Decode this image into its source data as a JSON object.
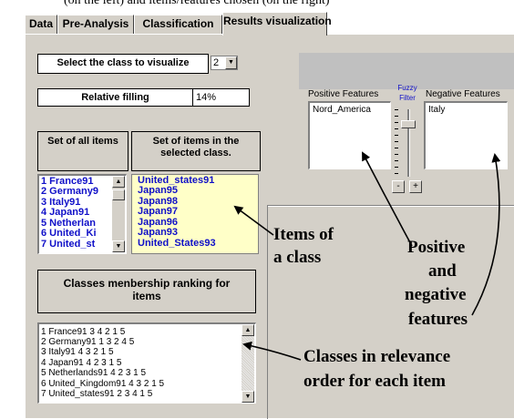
{
  "top_caption": "(on the left) and items/features chosen  (on the right)",
  "tabs": [
    {
      "label": "Data"
    },
    {
      "label": "Pre-Analysis"
    },
    {
      "label": "Classification"
    },
    {
      "label": "Results visualization",
      "active": true
    }
  ],
  "class_select": {
    "label": "Select the class to visualize",
    "value": "2"
  },
  "relative_filling": {
    "label": "Relative filling",
    "value": "14%"
  },
  "all_items": {
    "header": "Set of all items",
    "items": [
      "1  France91",
      "2  Germany9",
      "3  Italy91",
      "4  Japan91",
      "5  Netherlan",
      "6  United_Ki",
      "7  United_st"
    ]
  },
  "selected_class": {
    "header": "Set of items in the selected class.",
    "items": [
      "United_states91",
      "Japan95",
      "Japan98",
      "Japan97",
      "Japan96",
      "Japan93",
      "United_States93"
    ]
  },
  "features": {
    "positive_label": "Positive Features",
    "negative_label": "Negative Features",
    "fuzzy_label": "Fuzzy Filter",
    "positive_items": [
      "Nord_America"
    ],
    "negative_items": [
      "Italy"
    ],
    "minus_label": "-",
    "plus_label": "+"
  },
  "ranking": {
    "header": "Classes menbership ranking for items",
    "rows": [
      "1  France91    3  4  2  1  5",
      "2  Germany91    1  3  2  4  5",
      "3  Italy91    4  3  2  1  5",
      "4  Japan91    4  2  3  1  5",
      "5  Netherlands91    4  2  3  1  5",
      "6  United_Kingdom91    4  3  2  1  5",
      "7  United_states91    2  3  4  1  5"
    ]
  },
  "annotations": {
    "items_of_class": [
      "Items of",
      "a class"
    ],
    "pos_neg": [
      "Positive",
      "and",
      "negative",
      "features"
    ],
    "relevance": [
      "Classes in relevance",
      "order for each  item"
    ]
  }
}
